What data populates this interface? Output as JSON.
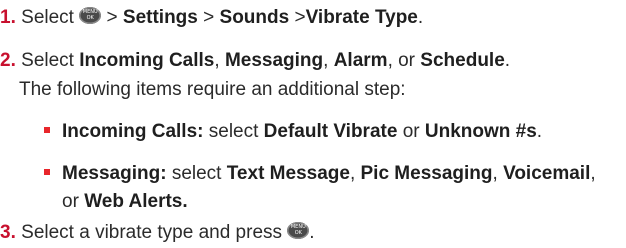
{
  "menu_key": {
    "line1": "MENU",
    "line2": "OK"
  },
  "step1": {
    "number": "1.",
    "select": "Select",
    "sep1": ">",
    "settings": "Settings",
    "sep2": ">",
    "sounds": "Sounds",
    "sep3": ">",
    "vibrate_type": "Vibrate Type",
    "end": "."
  },
  "step2": {
    "number": "2.",
    "select": "Select",
    "incoming_calls": "Incoming Calls",
    "comma1": ",",
    "messaging": "Messaging",
    "comma2": ",",
    "alarm": "Alarm",
    "or": ", or",
    "schedule": "Schedule",
    "end": ".",
    "additional": "The following items require an additional step:",
    "bullets": [
      {
        "label": "Incoming Calls:",
        "select": "select",
        "opt1": "Default Vibrate",
        "or": "or",
        "opt2": "Unknown #s",
        "end": "."
      },
      {
        "label": "Messaging:",
        "select": "select",
        "opt1": "Text Message",
        "comma1": ",",
        "opt2": "Pic Messaging",
        "comma2": ",",
        "opt3": "Voicemail",
        "comma3": ",",
        "or": "or",
        "opt4": "Web Alerts."
      }
    ]
  },
  "step3": {
    "number": "3.",
    "text": "Select a vibrate type and press",
    "end": "."
  }
}
